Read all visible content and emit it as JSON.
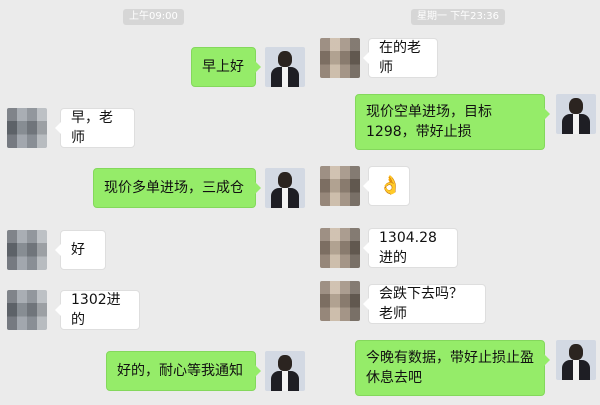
{
  "left_chat": {
    "timestamp": "上午09:00",
    "messages": [
      {
        "from": "me",
        "text": "早上好"
      },
      {
        "from": "teacher",
        "text": "早，老师"
      },
      {
        "from": "me",
        "text": "现价多单进场，三成仓"
      },
      {
        "from": "teacher",
        "text": "好"
      },
      {
        "from": "teacher",
        "text": "1302进的"
      },
      {
        "from": "me",
        "text": "好的，耐心等我通知"
      }
    ]
  },
  "right_chat": {
    "timestamp": "星期一 下午23:36",
    "messages": [
      {
        "from": "teacher",
        "text": "在的老师"
      },
      {
        "from": "me",
        "text": "现价空单进场，目标1298，带好止损"
      },
      {
        "from": "teacher",
        "text": "👌",
        "icon": "ok-hand-emoji-icon"
      },
      {
        "from": "teacher",
        "text": "1304.28进的"
      },
      {
        "from": "teacher",
        "text": "会跌下去吗？老师"
      },
      {
        "from": "me",
        "text": "今晚有数据，带好止损止盈休息去吧"
      }
    ]
  },
  "colors": {
    "me_bubble": "#95ec69",
    "other_bubble": "#ffffff",
    "background": "#ebebeb"
  }
}
